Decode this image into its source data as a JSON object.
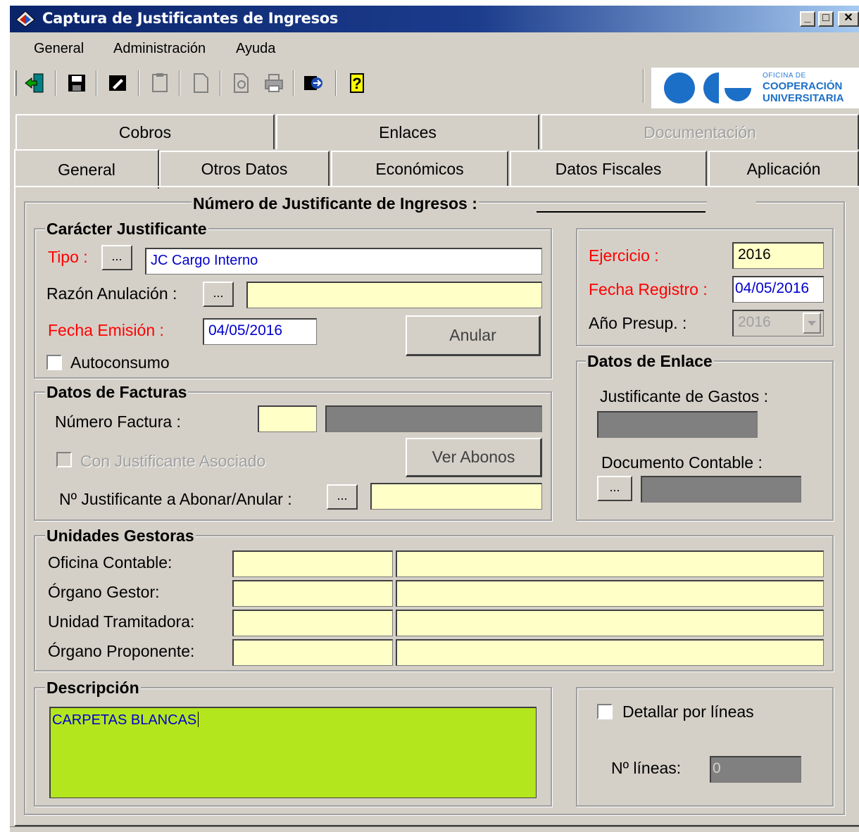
{
  "window": {
    "title": "Captura de Justificantes de Ingresos"
  },
  "menu": [
    "General",
    "Administración",
    "Ayuda"
  ],
  "logo": {
    "line1": "OFICINA DE",
    "line2": "COOPERACIÓN",
    "line3": "UNIVERSITARIA"
  },
  "tabs": {
    "row1": [
      "Cobros",
      "Enlaces",
      "Documentación"
    ],
    "row2": [
      "General",
      "Otros Datos",
      "Económicos",
      "Datos Fiscales",
      "Aplicación"
    ]
  },
  "header": {
    "numero_label": "Número de Justificante de Ingresos :"
  },
  "caracter": {
    "title": "Carácter Justificante",
    "tipo_label": "Tipo :",
    "tipo_value": "JC  Cargo Interno",
    "razon_label": "Razón Anulación :",
    "razon_value": "",
    "fecha_emision_label": "Fecha Emisión :",
    "fecha_emision_value": "04/05/2016",
    "anular_button": "Anular",
    "autoconsumo_label": "Autoconsumo"
  },
  "ejercicio": {
    "ejercicio_label": "Ejercicio :",
    "ejercicio_value": "2016",
    "fecha_registro_label": "Fecha Registro :",
    "fecha_registro_value": "04/05/2016",
    "anio_presup_label": "Año Presup. :",
    "anio_presup_value": "2016"
  },
  "facturas": {
    "title": "Datos de Facturas",
    "numero_factura_label": "Número Factura :",
    "con_justificante_label": "Con Justificante Asociado",
    "ver_abonos_button": "Ver Abonos",
    "n_justificante_label": "Nº Justificante a Abonar/Anular :"
  },
  "enlace": {
    "title": "Datos de Enlace",
    "justificante_gastos_label": "Justificante de Gastos :",
    "documento_contable_label": "Documento Contable :"
  },
  "unidades": {
    "title": "Unidades Gestoras",
    "rows": [
      "Oficina Contable:",
      "Órgano Gestor:",
      "Unidad Tramitadora:",
      "Órgano Proponente:"
    ]
  },
  "descripcion": {
    "title": "Descripción",
    "value": "CARPETAS BLANCAS"
  },
  "lineas": {
    "detallar_label": "Detallar por líneas",
    "n_lineas_label": "Nº líneas:",
    "n_lineas_value": "0"
  },
  "buttons": {
    "dots": "..."
  }
}
